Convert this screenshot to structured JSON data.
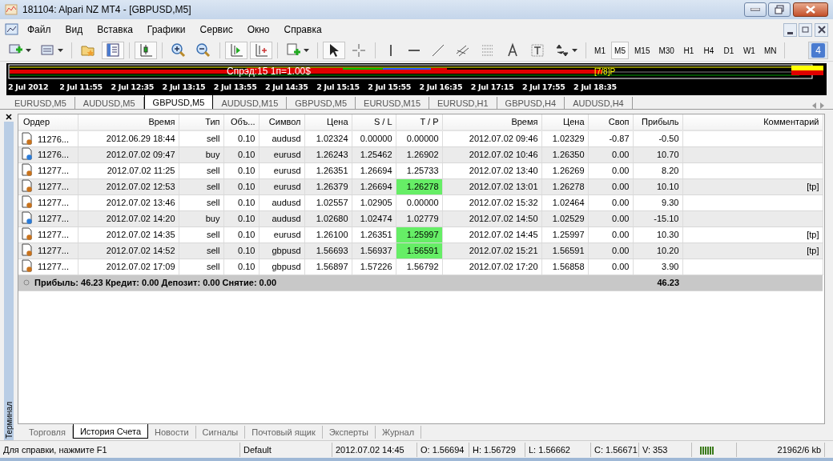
{
  "window": {
    "title": "181104: Alpari NZ MT4 - [GBPUSD,M5]"
  },
  "menu": [
    "Файл",
    "Вид",
    "Вставка",
    "Графики",
    "Сервис",
    "Окно",
    "Справка"
  ],
  "timeframes": [
    {
      "label": "M1",
      "selected": false
    },
    {
      "label": "M5",
      "selected": true
    },
    {
      "label": "M15",
      "selected": false
    },
    {
      "label": "M30",
      "selected": false
    },
    {
      "label": "H1",
      "selected": false
    },
    {
      "label": "H4",
      "selected": false
    },
    {
      "label": "D1",
      "selected": false
    },
    {
      "label": "W1",
      "selected": false
    },
    {
      "label": "MN",
      "selected": false
    }
  ],
  "messages_badge": "4",
  "chart": {
    "info": "Спрэд:15  1п=1.00$",
    "level_label": "[7/8]P",
    "time_labels": [
      "2 Jul 2012",
      "2 Jul 11:55",
      "2 Jul 12:35",
      "2 Jul 13:15",
      "2 Jul 13:55",
      "2 Jul 14:35",
      "2 Jul 15:15",
      "2 Jul 15:55",
      "2 Jul 16:35",
      "2 Jul 17:15",
      "2 Jul 17:55",
      "2 Jul 18:35"
    ]
  },
  "chart_tabs": [
    {
      "label": "EURUSD,M5",
      "selected": false
    },
    {
      "label": "AUDUSD,M5",
      "selected": false
    },
    {
      "label": "GBPUSD,M5",
      "selected": true
    },
    {
      "label": "AUDUSD,M15",
      "selected": false
    },
    {
      "label": "GBPUSD,M5",
      "selected": false
    },
    {
      "label": "EURUSD,M15",
      "selected": false
    },
    {
      "label": "EURUSD,H1",
      "selected": false
    },
    {
      "label": "GBPUSD,H4",
      "selected": false
    },
    {
      "label": "AUDUSD,H4",
      "selected": false
    }
  ],
  "terminal": {
    "side_label": "Терминал",
    "columns": [
      "Ордер",
      "Время",
      "Тип",
      "Объ...",
      "Символ",
      "Цена",
      "S / L",
      "T / P",
      "Время",
      "Цена",
      "Своп",
      "Прибыль",
      "Комментарий"
    ],
    "rows": [
      {
        "kind": "sell",
        "cells": [
          "11276...",
          "2012.06.29 18:44",
          "sell",
          "0.10",
          "audusd",
          "1.02324",
          "0.00000",
          "0.00000",
          "2012.07.02 09:46",
          "1.02329",
          "-0.87",
          "-0.50"
        ],
        "tp_hit": false
      },
      {
        "kind": "buy",
        "cells": [
          "11276...",
          "2012.07.02 09:47",
          "buy",
          "0.10",
          "eurusd",
          "1.26243",
          "1.25462",
          "1.26902",
          "2012.07.02 10:46",
          "1.26350",
          "0.00",
          "10.70"
        ],
        "tp_hit": false
      },
      {
        "kind": "sell",
        "cells": [
          "11277...",
          "2012.07.02 11:25",
          "sell",
          "0.10",
          "eurusd",
          "1.26351",
          "1.26694",
          "1.25733",
          "2012.07.02 13:40",
          "1.26269",
          "0.00",
          "8.20"
        ],
        "tp_hit": false
      },
      {
        "kind": "sell",
        "cells": [
          "11277...",
          "2012.07.02 12:53",
          "sell",
          "0.10",
          "eurusd",
          "1.26379",
          "1.26694",
          "1.26278",
          "2012.07.02 13:01",
          "1.26278",
          "0.00",
          "10.10",
          "[tp]"
        ],
        "tp_hit": true
      },
      {
        "kind": "sell",
        "cells": [
          "11277...",
          "2012.07.02 13:46",
          "sell",
          "0.10",
          "audusd",
          "1.02557",
          "1.02905",
          "0.00000",
          "2012.07.02 15:32",
          "1.02464",
          "0.00",
          "9.30"
        ],
        "tp_hit": false
      },
      {
        "kind": "buy",
        "cells": [
          "11277...",
          "2012.07.02 14:20",
          "buy",
          "0.10",
          "audusd",
          "1.02680",
          "1.02474",
          "1.02779",
          "2012.07.02 14:50",
          "1.02529",
          "0.00",
          "-15.10"
        ],
        "tp_hit": false
      },
      {
        "kind": "sell",
        "cells": [
          "11277...",
          "2012.07.02 14:35",
          "sell",
          "0.10",
          "eurusd",
          "1.26100",
          "1.26351",
          "1.25997",
          "2012.07.02 14:45",
          "1.25997",
          "0.00",
          "10.30",
          "[tp]"
        ],
        "tp_hit": true
      },
      {
        "kind": "sell",
        "cells": [
          "11277...",
          "2012.07.02 14:52",
          "sell",
          "0.10",
          "gbpusd",
          "1.56693",
          "1.56937",
          "1.56591",
          "2012.07.02 15:21",
          "1.56591",
          "0.00",
          "10.20",
          "[tp]"
        ],
        "tp_hit": true
      },
      {
        "kind": "sell",
        "cells": [
          "11277...",
          "2012.07.02 17:09",
          "sell",
          "0.10",
          "gbpusd",
          "1.56897",
          "1.57226",
          "1.56792",
          "2012.07.02 17:20",
          "1.56858",
          "0.00",
          "3.90"
        ],
        "tp_hit": false
      }
    ],
    "summary": {
      "text": "Прибыль: 46.23  Кредит: 0.00  Депозит: 0.00  Снятие: 0.00",
      "total": "46.23"
    },
    "tabs": [
      {
        "label": "Торговля",
        "selected": false
      },
      {
        "label": "История Счета",
        "selected": true
      },
      {
        "label": "Новости",
        "selected": false
      },
      {
        "label": "Сигналы",
        "selected": false
      },
      {
        "label": "Почтовый ящик",
        "selected": false
      },
      {
        "label": "Эксперты",
        "selected": false
      },
      {
        "label": "Журнал",
        "selected": false
      }
    ]
  },
  "status_bar": [
    "Для справки, нажмите F1",
    "Default",
    "2012.07.02 14:45",
    "O: 1.56694",
    "H: 1.56729",
    "L: 1.56662",
    "C: 1.56671",
    "V: 353",
    "21962/6 kb"
  ]
}
